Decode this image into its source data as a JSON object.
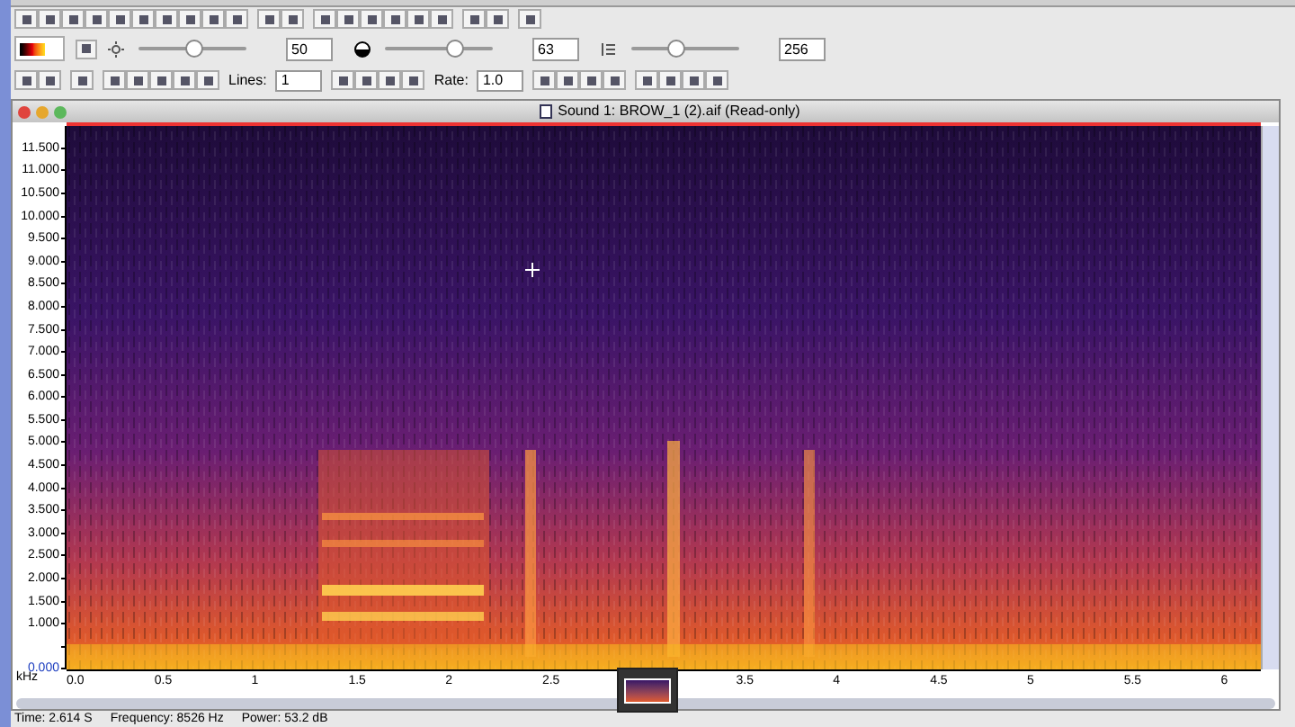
{
  "sliders": [
    {
      "kind": "sun",
      "level": 0.52,
      "value": "50"
    },
    {
      "kind": "contrast",
      "level": 0.65,
      "value": "63"
    },
    {
      "kind": "lines",
      "level": 0.42,
      "value": "256"
    }
  ],
  "lines_field": {
    "label": "Lines:",
    "value": "1"
  },
  "rate_field": {
    "label": "Rate:",
    "value": "1.0"
  },
  "window": {
    "title": "Sound 1: BROW_1 (2).aif (Read-only)"
  },
  "y_axis": {
    "unit": "kHz",
    "labels": [
      "11.500",
      "11.000",
      "10.500",
      "10.000",
      "9.500",
      "9.000",
      "8.500",
      "8.000",
      "7.500",
      "7.000",
      "6.500",
      "6.000",
      "5.500",
      "5.000",
      "4.500",
      "4.000",
      "3.500",
      "3.000",
      "2.500",
      "2.000",
      "1.500",
      "1.000",
      "0.000"
    ]
  },
  "x_axis": {
    "labels": [
      "0.0",
      "0.5",
      "1",
      "1.5",
      "2",
      "2.5",
      "3.5",
      "4",
      "4.5",
      "5",
      "5.5",
      "6"
    ]
  },
  "status_bar": [
    "Time: 2.614 S",
    "Frequency: 8526 Hz",
    "Power: 53.2 dB"
  ]
}
